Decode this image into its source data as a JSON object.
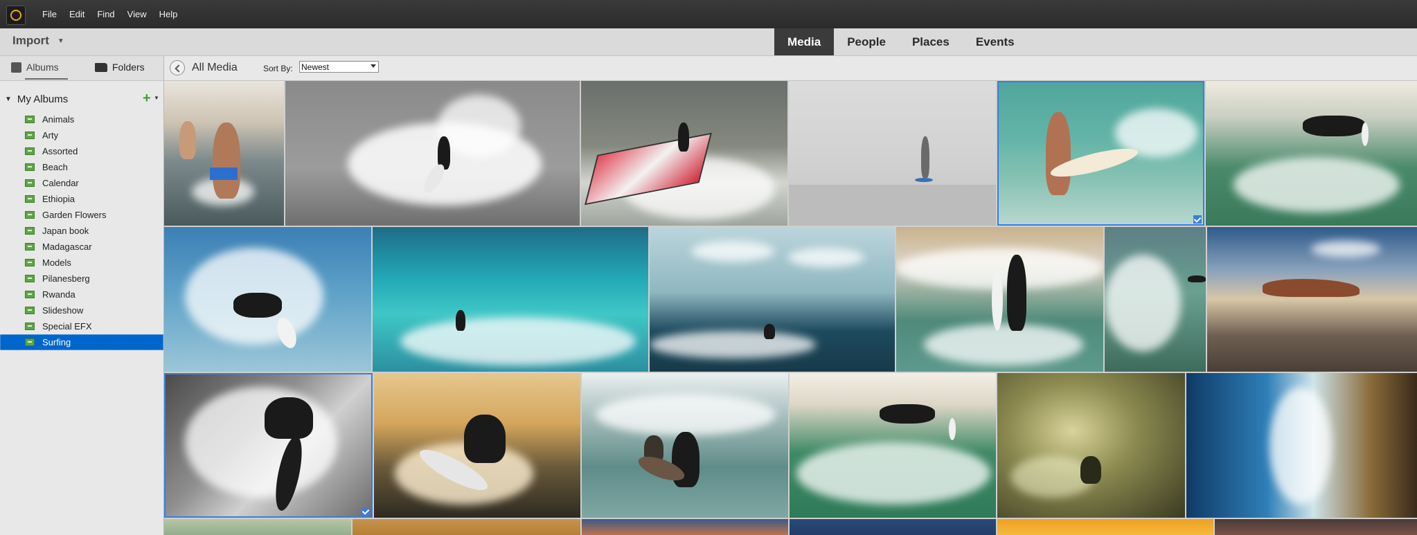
{
  "menu": [
    "File",
    "Edit",
    "Find",
    "View",
    "Help"
  ],
  "topbar": {
    "import_label": "Import",
    "tabs": [
      {
        "label": "Media",
        "active": true
      },
      {
        "label": "People",
        "active": false
      },
      {
        "label": "Places",
        "active": false
      },
      {
        "label": "Events",
        "active": false
      }
    ]
  },
  "sidebar": {
    "tabs": {
      "albums": "Albums",
      "folders": "Folders"
    },
    "section_title": "My Albums",
    "albums": [
      "Animals",
      "Arty",
      "Assorted",
      "Beach",
      "Calendar",
      "Ethiopia",
      "Garden Flowers",
      "Japan book",
      "Madagascar",
      "Models",
      "Pilanesberg",
      "Rwanda",
      "Slideshow",
      "Special EFX",
      "Surfing"
    ],
    "selected_album": "Surfing"
  },
  "content": {
    "breadcrumb": "All Media",
    "sort_label": "Sort By:",
    "sort_value": "Newest"
  },
  "colors": {
    "accent": "#0066cc",
    "selection": "#3b7de0",
    "album_icon": "#5ea646"
  }
}
